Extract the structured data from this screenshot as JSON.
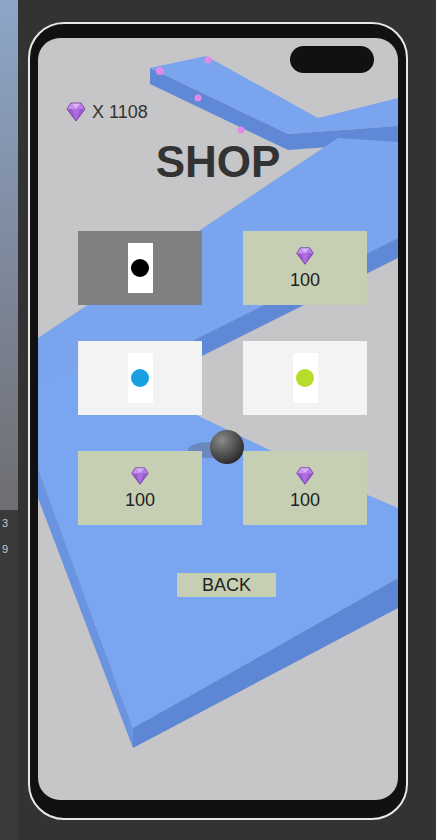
{
  "currency": {
    "count": "X 1108"
  },
  "title": "SHOP",
  "items": [
    {
      "kind": "skin",
      "selected": true,
      "color": "#000000"
    },
    {
      "kind": "locked",
      "selected": false,
      "price": "100"
    },
    {
      "kind": "skin",
      "selected": false,
      "color": "#1aa0e0"
    },
    {
      "kind": "skin",
      "selected": false,
      "color": "#b8dc2a"
    },
    {
      "kind": "locked",
      "selected": false,
      "price": "100"
    },
    {
      "kind": "locked",
      "selected": false,
      "price": "100"
    }
  ],
  "back_button": "BACK",
  "editor_edge": [
    "3",
    "9"
  ]
}
